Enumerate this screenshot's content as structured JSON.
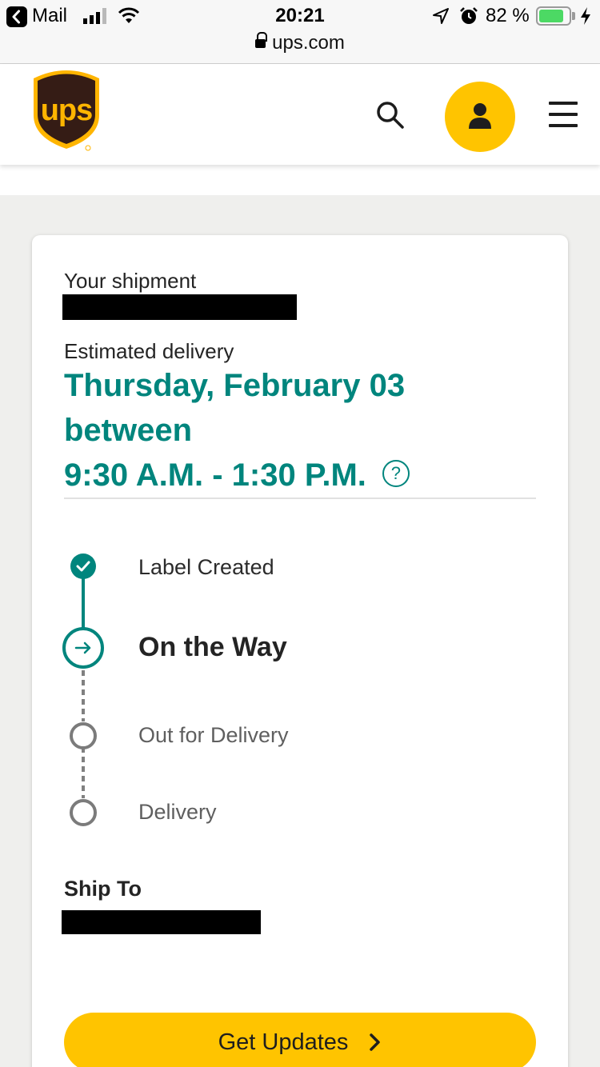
{
  "status_bar": {
    "back_app": "Mail",
    "time": "20:21",
    "url": "ups.com",
    "battery_percent": "82 %",
    "battery_level": 0.82
  },
  "header": {
    "logo_text": "ups",
    "icons": [
      "search-icon",
      "account-icon",
      "menu-icon"
    ]
  },
  "shipment": {
    "heading": "Your shipment",
    "estimated_label": "Estimated delivery",
    "eta_line1": "Thursday, February 03 between",
    "eta_line2": "9:30 A.M. - 1:30 P.M.",
    "help_symbol": "?"
  },
  "progress": {
    "steps": [
      {
        "label": "Label Created",
        "state": "done"
      },
      {
        "label": "On the Way",
        "state": "current"
      },
      {
        "label": "Out for Delivery",
        "state": "pending"
      },
      {
        "label": "Delivery",
        "state": "pending"
      }
    ]
  },
  "ship_to": {
    "label": "Ship To"
  },
  "actions": {
    "get_updates": "Get Updates"
  },
  "colors": {
    "ups_gold": "#ffc400",
    "ups_brown": "#351c15",
    "teal": "#00857d",
    "battery_green": "#4cd964"
  }
}
